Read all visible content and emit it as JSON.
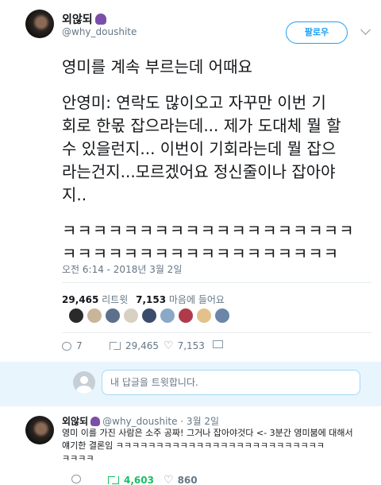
{
  "tweet": {
    "display_name": "외않되",
    "name_emoji": "person-gesturing-no-emoji",
    "handle": "@why_doushite",
    "follow_label": "팔로우",
    "text_line1": "영미를 계속 부르는데 어때요",
    "text_para2": "안영미: 연락도 많이오고 자꾸만 이번 기\n회로 한몫 잡으라는데... 제가 도대체 뭘 할\n수 있을런지... 이번이 기회라는데 뭘 잡으\n라는건지...모르겠어요 정신줄이나 잡아야\n지..",
    "text_para3": "ㅋㅋㅋㅋㅋㅋㅋㅋㅋㅋㅋㅋㅋㅋㅋㅋㅋㅋㅋ\nㅋㅋㅋㅋㅋㅋㅋㅋㅋㅋㅋㅋㅋㅋㅋㅋㅋㅋ",
    "timestamp": "오전 6:14 - 2018년 3월 2일"
  },
  "stats": {
    "retweets": "29,465",
    "retweets_label": "리트윗",
    "likes": "7,153",
    "likes_label": "마음에 들어요"
  },
  "liker_colors": [
    "#2a2a2a",
    "#c9b59a",
    "#5d6f8a",
    "#d9d0c4",
    "#3b4b6b",
    "#8aa8c8",
    "#b03a4a",
    "#e2c18a",
    "#6b86a8"
  ],
  "actions": {
    "reply_count": "7",
    "retweet_count": "29,465",
    "like_count": "7,153"
  },
  "reply_box": {
    "placeholder": "내 답글을 트윗합니다."
  },
  "reply_tweet": {
    "display_name": "외않되",
    "handle_date": "@why_doushite · 3월 2일",
    "text": "영미 이를 가진 사람은 소주 공짜! 그거나 잡아야것다 <- 3분간 영미붐에 대해서\n얘기한 결론임 ㅋㅋㅋㅋㅋㅋㅋㅋㅋㅋㅋㅋㅋㅋㅋㅋㅋㅋㅋㅋㅋㅋㅋㅋㅋㅋ\nㅋㅋㅋㅋ",
    "retweet_count": "4,603",
    "like_count": "860"
  },
  "colors": {
    "accent": "#1da1f2",
    "retweet_green": "#17bf63",
    "secondary_text": "#657786",
    "reply_box_bg": "#e8f5fd"
  }
}
